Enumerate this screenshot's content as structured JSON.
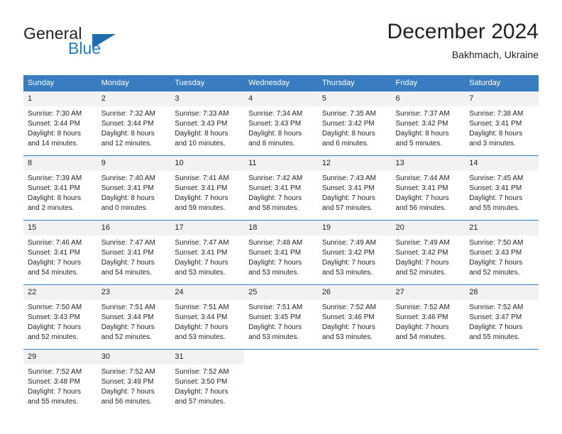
{
  "brand": {
    "name_part1": "General",
    "name_part2": "Blue",
    "accent_color": "#1f7ec4",
    "triangle_color": "#1f6cb0"
  },
  "header": {
    "title": "December 2024",
    "subtitle": "Bakhmach, Ukraine"
  },
  "calendar": {
    "header_color": "#3a7cc0",
    "daynum_bg": "#f2f2f2",
    "weekdays": [
      "Sunday",
      "Monday",
      "Tuesday",
      "Wednesday",
      "Thursday",
      "Friday",
      "Saturday"
    ],
    "weeks": [
      [
        {
          "day": "1",
          "sunrise": "Sunrise: 7:30 AM",
          "sunset": "Sunset: 3:44 PM",
          "daylight1": "Daylight: 8 hours",
          "daylight2": "and 14 minutes."
        },
        {
          "day": "2",
          "sunrise": "Sunrise: 7:32 AM",
          "sunset": "Sunset: 3:44 PM",
          "daylight1": "Daylight: 8 hours",
          "daylight2": "and 12 minutes."
        },
        {
          "day": "3",
          "sunrise": "Sunrise: 7:33 AM",
          "sunset": "Sunset: 3:43 PM",
          "daylight1": "Daylight: 8 hours",
          "daylight2": "and 10 minutes."
        },
        {
          "day": "4",
          "sunrise": "Sunrise: 7:34 AM",
          "sunset": "Sunset: 3:43 PM",
          "daylight1": "Daylight: 8 hours",
          "daylight2": "and 8 minutes."
        },
        {
          "day": "5",
          "sunrise": "Sunrise: 7:35 AM",
          "sunset": "Sunset: 3:42 PM",
          "daylight1": "Daylight: 8 hours",
          "daylight2": "and 6 minutes."
        },
        {
          "day": "6",
          "sunrise": "Sunrise: 7:37 AM",
          "sunset": "Sunset: 3:42 PM",
          "daylight1": "Daylight: 8 hours",
          "daylight2": "and 5 minutes."
        },
        {
          "day": "7",
          "sunrise": "Sunrise: 7:38 AM",
          "sunset": "Sunset: 3:41 PM",
          "daylight1": "Daylight: 8 hours",
          "daylight2": "and 3 minutes."
        }
      ],
      [
        {
          "day": "8",
          "sunrise": "Sunrise: 7:39 AM",
          "sunset": "Sunset: 3:41 PM",
          "daylight1": "Daylight: 8 hours",
          "daylight2": "and 2 minutes."
        },
        {
          "day": "9",
          "sunrise": "Sunrise: 7:40 AM",
          "sunset": "Sunset: 3:41 PM",
          "daylight1": "Daylight: 8 hours",
          "daylight2": "and 0 minutes."
        },
        {
          "day": "10",
          "sunrise": "Sunrise: 7:41 AM",
          "sunset": "Sunset: 3:41 PM",
          "daylight1": "Daylight: 7 hours",
          "daylight2": "and 59 minutes."
        },
        {
          "day": "11",
          "sunrise": "Sunrise: 7:42 AM",
          "sunset": "Sunset: 3:41 PM",
          "daylight1": "Daylight: 7 hours",
          "daylight2": "and 58 minutes."
        },
        {
          "day": "12",
          "sunrise": "Sunrise: 7:43 AM",
          "sunset": "Sunset: 3:41 PM",
          "daylight1": "Daylight: 7 hours",
          "daylight2": "and 57 minutes."
        },
        {
          "day": "13",
          "sunrise": "Sunrise: 7:44 AM",
          "sunset": "Sunset: 3:41 PM",
          "daylight1": "Daylight: 7 hours",
          "daylight2": "and 56 minutes."
        },
        {
          "day": "14",
          "sunrise": "Sunrise: 7:45 AM",
          "sunset": "Sunset: 3:41 PM",
          "daylight1": "Daylight: 7 hours",
          "daylight2": "and 55 minutes."
        }
      ],
      [
        {
          "day": "15",
          "sunrise": "Sunrise: 7:46 AM",
          "sunset": "Sunset: 3:41 PM",
          "daylight1": "Daylight: 7 hours",
          "daylight2": "and 54 minutes."
        },
        {
          "day": "16",
          "sunrise": "Sunrise: 7:47 AM",
          "sunset": "Sunset: 3:41 PM",
          "daylight1": "Daylight: 7 hours",
          "daylight2": "and 54 minutes."
        },
        {
          "day": "17",
          "sunrise": "Sunrise: 7:47 AM",
          "sunset": "Sunset: 3:41 PM",
          "daylight1": "Daylight: 7 hours",
          "daylight2": "and 53 minutes."
        },
        {
          "day": "18",
          "sunrise": "Sunrise: 7:48 AM",
          "sunset": "Sunset: 3:41 PM",
          "daylight1": "Daylight: 7 hours",
          "daylight2": "and 53 minutes."
        },
        {
          "day": "19",
          "sunrise": "Sunrise: 7:49 AM",
          "sunset": "Sunset: 3:42 PM",
          "daylight1": "Daylight: 7 hours",
          "daylight2": "and 53 minutes."
        },
        {
          "day": "20",
          "sunrise": "Sunrise: 7:49 AM",
          "sunset": "Sunset: 3:42 PM",
          "daylight1": "Daylight: 7 hours",
          "daylight2": "and 52 minutes."
        },
        {
          "day": "21",
          "sunrise": "Sunrise: 7:50 AM",
          "sunset": "Sunset: 3:43 PM",
          "daylight1": "Daylight: 7 hours",
          "daylight2": "and 52 minutes."
        }
      ],
      [
        {
          "day": "22",
          "sunrise": "Sunrise: 7:50 AM",
          "sunset": "Sunset: 3:43 PM",
          "daylight1": "Daylight: 7 hours",
          "daylight2": "and 52 minutes."
        },
        {
          "day": "23",
          "sunrise": "Sunrise: 7:51 AM",
          "sunset": "Sunset: 3:44 PM",
          "daylight1": "Daylight: 7 hours",
          "daylight2": "and 52 minutes."
        },
        {
          "day": "24",
          "sunrise": "Sunrise: 7:51 AM",
          "sunset": "Sunset: 3:44 PM",
          "daylight1": "Daylight: 7 hours",
          "daylight2": "and 53 minutes."
        },
        {
          "day": "25",
          "sunrise": "Sunrise: 7:51 AM",
          "sunset": "Sunset: 3:45 PM",
          "daylight1": "Daylight: 7 hours",
          "daylight2": "and 53 minutes."
        },
        {
          "day": "26",
          "sunrise": "Sunrise: 7:52 AM",
          "sunset": "Sunset: 3:46 PM",
          "daylight1": "Daylight: 7 hours",
          "daylight2": "and 53 minutes."
        },
        {
          "day": "27",
          "sunrise": "Sunrise: 7:52 AM",
          "sunset": "Sunset: 3:46 PM",
          "daylight1": "Daylight: 7 hours",
          "daylight2": "and 54 minutes."
        },
        {
          "day": "28",
          "sunrise": "Sunrise: 7:52 AM",
          "sunset": "Sunset: 3:47 PM",
          "daylight1": "Daylight: 7 hours",
          "daylight2": "and 55 minutes."
        }
      ],
      [
        {
          "day": "29",
          "sunrise": "Sunrise: 7:52 AM",
          "sunset": "Sunset: 3:48 PM",
          "daylight1": "Daylight: 7 hours",
          "daylight2": "and 55 minutes."
        },
        {
          "day": "30",
          "sunrise": "Sunrise: 7:52 AM",
          "sunset": "Sunset: 3:49 PM",
          "daylight1": "Daylight: 7 hours",
          "daylight2": "and 56 minutes."
        },
        {
          "day": "31",
          "sunrise": "Sunrise: 7:52 AM",
          "sunset": "Sunset: 3:50 PM",
          "daylight1": "Daylight: 7 hours",
          "daylight2": "and 57 minutes."
        },
        {
          "day": "",
          "sunrise": "",
          "sunset": "",
          "daylight1": "",
          "daylight2": ""
        },
        {
          "day": "",
          "sunrise": "",
          "sunset": "",
          "daylight1": "",
          "daylight2": ""
        },
        {
          "day": "",
          "sunrise": "",
          "sunset": "",
          "daylight1": "",
          "daylight2": ""
        },
        {
          "day": "",
          "sunrise": "",
          "sunset": "",
          "daylight1": "",
          "daylight2": ""
        }
      ]
    ]
  }
}
